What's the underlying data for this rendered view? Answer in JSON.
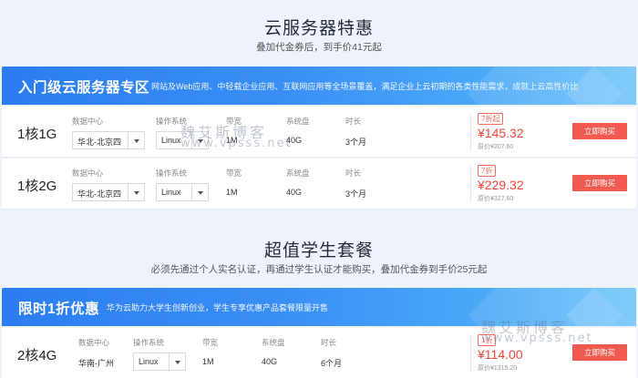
{
  "section1": {
    "title": "云服务器特惠",
    "subtitle": "叠加代金券后，到手价41元起",
    "banner": {
      "title": "入门级云服务器专区",
      "desc": "网站及Web应用、中轻载企业应用、互联网应用等全场景覆盖，满足企业上云初期的各类性能需求，成就上云高性价比"
    },
    "labels": {
      "datacenter": "数据中心",
      "os": "操作系统",
      "bandwidth": "带宽",
      "disk": "系统盘",
      "duration": "时长"
    },
    "buy_label": "立即购买",
    "rows": [
      {
        "spec": "1核1G",
        "datacenter": "华北-北京四",
        "os": "Linux",
        "bandwidth": "1M",
        "disk": "40G",
        "duration": "3个月",
        "badge": "7折起",
        "price": "¥145.32",
        "orig": "原价¥207.60"
      },
      {
        "spec": "1核2G",
        "datacenter": "华北-北京四",
        "os": "Linux",
        "bandwidth": "1M",
        "disk": "40G",
        "duration": "3个月",
        "badge": "7折",
        "price": "¥229.32",
        "orig": "原价¥327.60"
      }
    ]
  },
  "section2": {
    "title": "超值学生套餐",
    "subtitle": "必须先通过个人实名认证，再通过学生认证才能购买，叠加代金券到手价25元起",
    "banner": {
      "title": "限时1折优惠",
      "desc": "华为云助力大学生创新创业，学生专享优惠产品套餐限量开售"
    },
    "labels": {
      "datacenter": "数据中心",
      "os": "操作系统",
      "bandwidth": "带宽",
      "disk": "系统盘",
      "duration": "时长"
    },
    "buy_label": "立即购买",
    "rows": [
      {
        "spec": "2核4G",
        "datacenter": "华南-广州",
        "os": "Linux",
        "bandwidth": "1M",
        "disk": "40G",
        "duration": "6个月",
        "badge": "1折",
        "price": "¥114.00",
        "orig": "原价¥1315.20"
      }
    ]
  },
  "watermark": {
    "cn": "魏艾斯博客",
    "url": "www.vpsss.net"
  },
  "colors": {
    "banner": "#2b7df0",
    "price": "#f0473a",
    "buy_button": "#f05a4f"
  }
}
